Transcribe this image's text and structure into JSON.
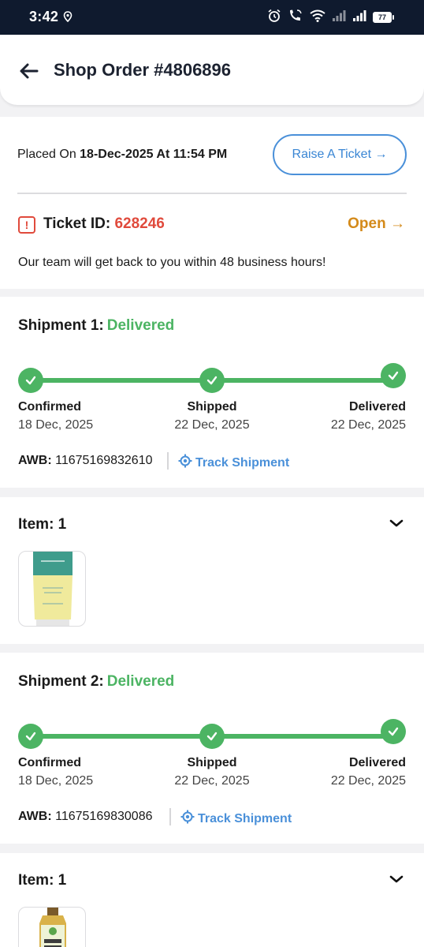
{
  "status_bar": {
    "time": "3:42",
    "battery": "77",
    "icons": [
      "location-icon",
      "alarm-icon",
      "wifi-call-icon",
      "wifi-icon",
      "signal-icon",
      "signal-icon",
      "battery-icon"
    ]
  },
  "header": {
    "title": "Shop Order #4806896",
    "back_icon": "arrow-left-icon"
  },
  "order": {
    "placed_prefix": "Placed On ",
    "placed_date": "18-Dec-2025 At 11:54 PM",
    "raise_ticket_label": "Raise A Ticket →",
    "ticket_label": "Ticket ID: ",
    "ticket_id": "628246",
    "ticket_status": "Open →",
    "team_message": "Our team will get back to you within 48 business hours!"
  },
  "shipments": [
    {
      "title": "Shipment 1:",
      "status": "Delivered",
      "steps": [
        {
          "label": "Confirmed",
          "date": "18 Dec, 2025"
        },
        {
          "label": "Shipped",
          "date": "22 Dec, 2025"
        },
        {
          "label": "Delivered",
          "date": "22 Dec, 2025"
        }
      ],
      "awb_label": "AWB:",
      "awb": "11675169832610",
      "track_label": "Track Shipment",
      "item_title": "Item: 1"
    },
    {
      "title": "Shipment 2:",
      "status": "Delivered",
      "steps": [
        {
          "label": "Confirmed",
          "date": "18 Dec, 2025"
        },
        {
          "label": "Shipped",
          "date": "22 Dec, 2025"
        },
        {
          "label": "Delivered",
          "date": "22 Dec, 2025"
        }
      ],
      "awb_label": "AWB:",
      "awb": "11675169830086",
      "track_label": "Track Shipment",
      "item_title": "Item: 1"
    }
  ],
  "colors": {
    "accent_blue": "#4a90d9",
    "success_green": "#4cb463",
    "ticket_red": "#e04a3c",
    "open_orange": "#d48a1a",
    "status_bar_bg": "#0f1a2e"
  }
}
